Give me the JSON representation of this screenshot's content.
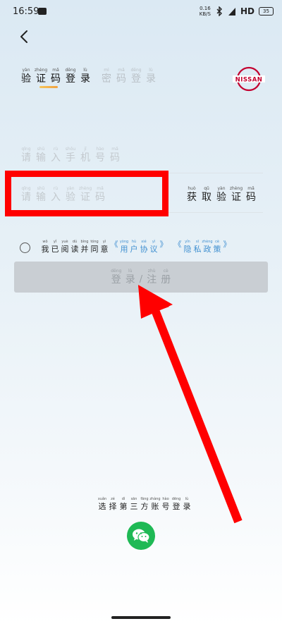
{
  "status_bar": {
    "time": "16:59",
    "net_speed_value": "0.16",
    "net_speed_unit": "KB/S",
    "network": "HD",
    "battery": "35"
  },
  "tabs": {
    "active": [
      {
        "hz": "验",
        "py": "yàn"
      },
      {
        "hz": "证",
        "py": "zhèng"
      },
      {
        "hz": "码",
        "py": "mǎ"
      },
      {
        "hz": "登",
        "py": "dēng"
      },
      {
        "hz": "录",
        "py": "lù"
      }
    ],
    "inactive": [
      {
        "hz": "密",
        "py": "mì"
      },
      {
        "hz": "码",
        "py": "mǎ"
      },
      {
        "hz": "登",
        "py": "dēng"
      },
      {
        "hz": "录",
        "py": "lù"
      }
    ]
  },
  "brand": {
    "logo_text": "NISSAN",
    "color": "#c3002f"
  },
  "phone_field": {
    "placeholder": [
      {
        "hz": "请",
        "py": "qǐng"
      },
      {
        "hz": "输",
        "py": "shū"
      },
      {
        "hz": "入",
        "py": "rù"
      },
      {
        "hz": "手",
        "py": "shǒu"
      },
      {
        "hz": "机",
        "py": "jī"
      },
      {
        "hz": "号",
        "py": "hào"
      },
      {
        "hz": "码",
        "py": "mǎ"
      }
    ]
  },
  "code_field": {
    "placeholder": [
      {
        "hz": "请",
        "py": "qǐng"
      },
      {
        "hz": "输",
        "py": "shū"
      },
      {
        "hz": "入",
        "py": "rù"
      },
      {
        "hz": "验",
        "py": "yàn"
      },
      {
        "hz": "证",
        "py": "zhèng"
      },
      {
        "hz": "码",
        "py": "mǎ"
      }
    ],
    "get_code": [
      {
        "hz": "获",
        "py": "huò"
      },
      {
        "hz": "取",
        "py": "qǔ"
      },
      {
        "hz": "验",
        "py": "yàn"
      },
      {
        "hz": "证",
        "py": "zhèng"
      },
      {
        "hz": "码",
        "py": "mǎ"
      }
    ]
  },
  "agreement": {
    "prefix": [
      {
        "hz": "我",
        "py": "wǒ"
      },
      {
        "hz": "已",
        "py": "yǐ"
      },
      {
        "hz": "阅",
        "py": "yuè"
      },
      {
        "hz": "读",
        "py": "dú"
      },
      {
        "hz": "并",
        "py": "bìng"
      },
      {
        "hz": "同",
        "py": "tóng"
      },
      {
        "hz": "意",
        "py": "yì"
      }
    ],
    "user_agreement": [
      {
        "hz": "《",
        "py": ""
      },
      {
        "hz": "用",
        "py": "yòng"
      },
      {
        "hz": "户",
        "py": "hù"
      },
      {
        "hz": "协",
        "py": "xié"
      },
      {
        "hz": "议",
        "py": "yì"
      },
      {
        "hz": "》",
        "py": ""
      }
    ],
    "privacy_policy": [
      {
        "hz": "《",
        "py": ""
      },
      {
        "hz": "隐",
        "py": "yǐn"
      },
      {
        "hz": "私",
        "py": "sī"
      },
      {
        "hz": "政",
        "py": "zhèng"
      },
      {
        "hz": "策",
        "py": "cè"
      },
      {
        "hz": "》",
        "py": ""
      }
    ],
    "link_color": "#3f8fd0"
  },
  "login_button": {
    "part1": [
      {
        "hz": "登",
        "py": "dēng"
      },
      {
        "hz": "录",
        "py": "lù"
      }
    ],
    "separator": "/",
    "part2": [
      {
        "hz": "注",
        "py": "zhù"
      },
      {
        "hz": "册",
        "py": "cè"
      }
    ]
  },
  "third_party": {
    "label": [
      {
        "hz": "选",
        "py": "xuǎn"
      },
      {
        "hz": "择",
        "py": "zé"
      },
      {
        "hz": "第",
        "py": "dì"
      },
      {
        "hz": "三",
        "py": "sān"
      },
      {
        "hz": "方",
        "py": "fāng"
      },
      {
        "hz": "账",
        "py": "zhàng"
      },
      {
        "hz": "号",
        "py": "hào"
      },
      {
        "hz": "登",
        "py": "dēng"
      },
      {
        "hz": "录",
        "py": "lù"
      }
    ],
    "wechat_color": "#1fb955"
  },
  "annotation": {
    "color": "#ff0000"
  }
}
